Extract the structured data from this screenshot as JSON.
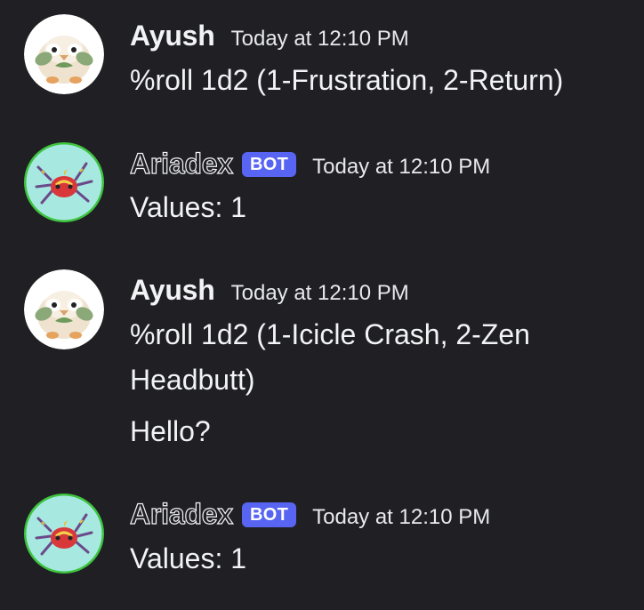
{
  "messages": [
    {
      "author": "Ayush",
      "is_bot": false,
      "avatar_icon": "rowlet-avatar",
      "timestamp": "Today at 12:10 PM",
      "lines": [
        "%roll 1d2 (1-Frustration, 2-Return)"
      ]
    },
    {
      "author": "Ariadex",
      "is_bot": true,
      "bot_badge": "BOT",
      "avatar_icon": "ariados-avatar",
      "timestamp": "Today at 12:10 PM",
      "lines": [
        "Values: 1"
      ]
    },
    {
      "author": "Ayush",
      "is_bot": false,
      "avatar_icon": "rowlet-avatar",
      "timestamp": "Today at 12:10 PM",
      "lines": [
        "%roll 1d2 (1-Icicle Crash, 2-Zen",
        "Headbutt)",
        "Hello?"
      ]
    },
    {
      "author": "Ariadex",
      "is_bot": true,
      "bot_badge": "BOT",
      "avatar_icon": "ariados-avatar",
      "timestamp": "Today at 12:10 PM",
      "lines": [
        "Values: 1"
      ]
    }
  ],
  "colors": {
    "background": "#1f1f24",
    "text": "#f2f3f5",
    "bot_badge": "#5865f2",
    "online_ring": "#3ba55c",
    "bot_avatar_bg": "#a7e8e0"
  }
}
